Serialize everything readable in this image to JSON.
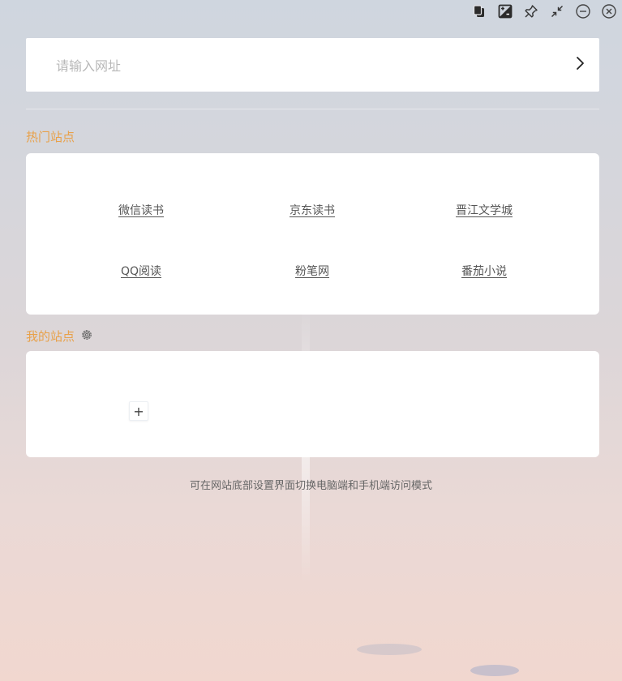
{
  "titlebar": {
    "buttons": [
      {
        "icon": "copy-icon"
      },
      {
        "icon": "contrast-icon"
      },
      {
        "icon": "pin-icon"
      },
      {
        "icon": "collapse-icon"
      },
      {
        "icon": "minimize-icon"
      },
      {
        "icon": "close-icon"
      }
    ]
  },
  "search": {
    "placeholder": "请输入网址",
    "value": ""
  },
  "hot_sites": {
    "title": "热门站点",
    "items": [
      {
        "label": "微信读书"
      },
      {
        "label": "京东读书"
      },
      {
        "label": "晋江文学城"
      },
      {
        "label": "QQ阅读"
      },
      {
        "label": "粉笔网"
      },
      {
        "label": "番茄小说"
      }
    ]
  },
  "my_sites": {
    "title": "我的站点",
    "add_label": "+"
  },
  "hint": "可在网站底部设置界面切换电脑端和手机端访问模式",
  "colors": {
    "accent": "#e8a14a",
    "card_bg": "#ffffff",
    "link_text": "#555555"
  }
}
